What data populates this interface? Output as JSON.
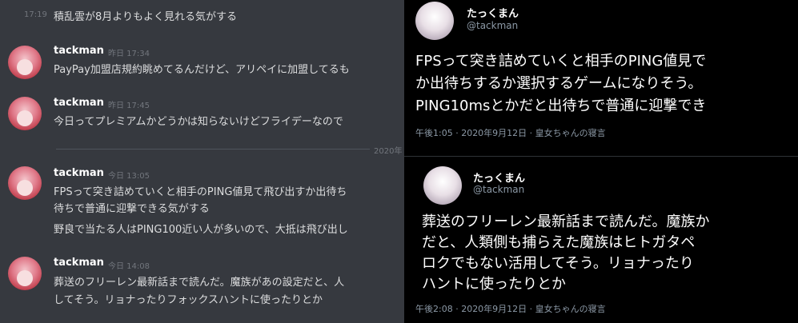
{
  "chat": {
    "top_message": {
      "time": "17:19",
      "text": "積乱雲が8月よりもよく見れる気がする"
    },
    "messages": [
      {
        "author": "tackman",
        "timestamp": "昨日 17:34",
        "lines": [
          "PayPay加盟店規約眺めてるんだけど、アリペイに加盟してるも"
        ]
      },
      {
        "author": "tackman",
        "timestamp": "昨日 17:45",
        "lines": [
          "今日ってプレミアムかどうかは知らないけどフライデーなので"
        ]
      },
      {
        "author": "tackman",
        "timestamp": "今日 13:05",
        "lines": [
          "FPSって突き詰めていくと相手のPING値見て飛び出すか出待ち",
          "待ちで普通に迎撃できる気がする",
          "野良で当たる人はPING100近い人が多いので、大抵は飛び出し"
        ]
      },
      {
        "author": "tackman",
        "timestamp": "今日 14:08",
        "lines": [
          "葬送のフリーレン最新話まで読んだ。魔族があの設定だと、人",
          "してそう。リョナったりフォックスハントに使ったりとか"
        ]
      }
    ],
    "date_divider": "2020年"
  },
  "tweets": [
    {
      "name": "たっくまん",
      "handle": "@tackman",
      "lines": [
        "FPSって突き詰めていくと相手のPING値見で",
        "か出待ちするか選択するゲームになりそう。",
        "PING10msとかだと出待ちで普通に迎撃でき"
      ],
      "meta": "午後1:05 · 2020年9月12日 · 皇女ちゃんの寝言"
    },
    {
      "name": "たっくまん",
      "handle": "@tackman",
      "lines": [
        "葬送のフリーレン最新話まで読んだ。魔族か",
        "だと、人類側も捕らえた魔族はヒトガタペ",
        "ロクでもない活用してそう。リョナったり",
        "ハントに使ったりとか"
      ],
      "meta": "午後2:08 · 2020年9月12日 · 皇女ちゃんの寝言"
    }
  ]
}
